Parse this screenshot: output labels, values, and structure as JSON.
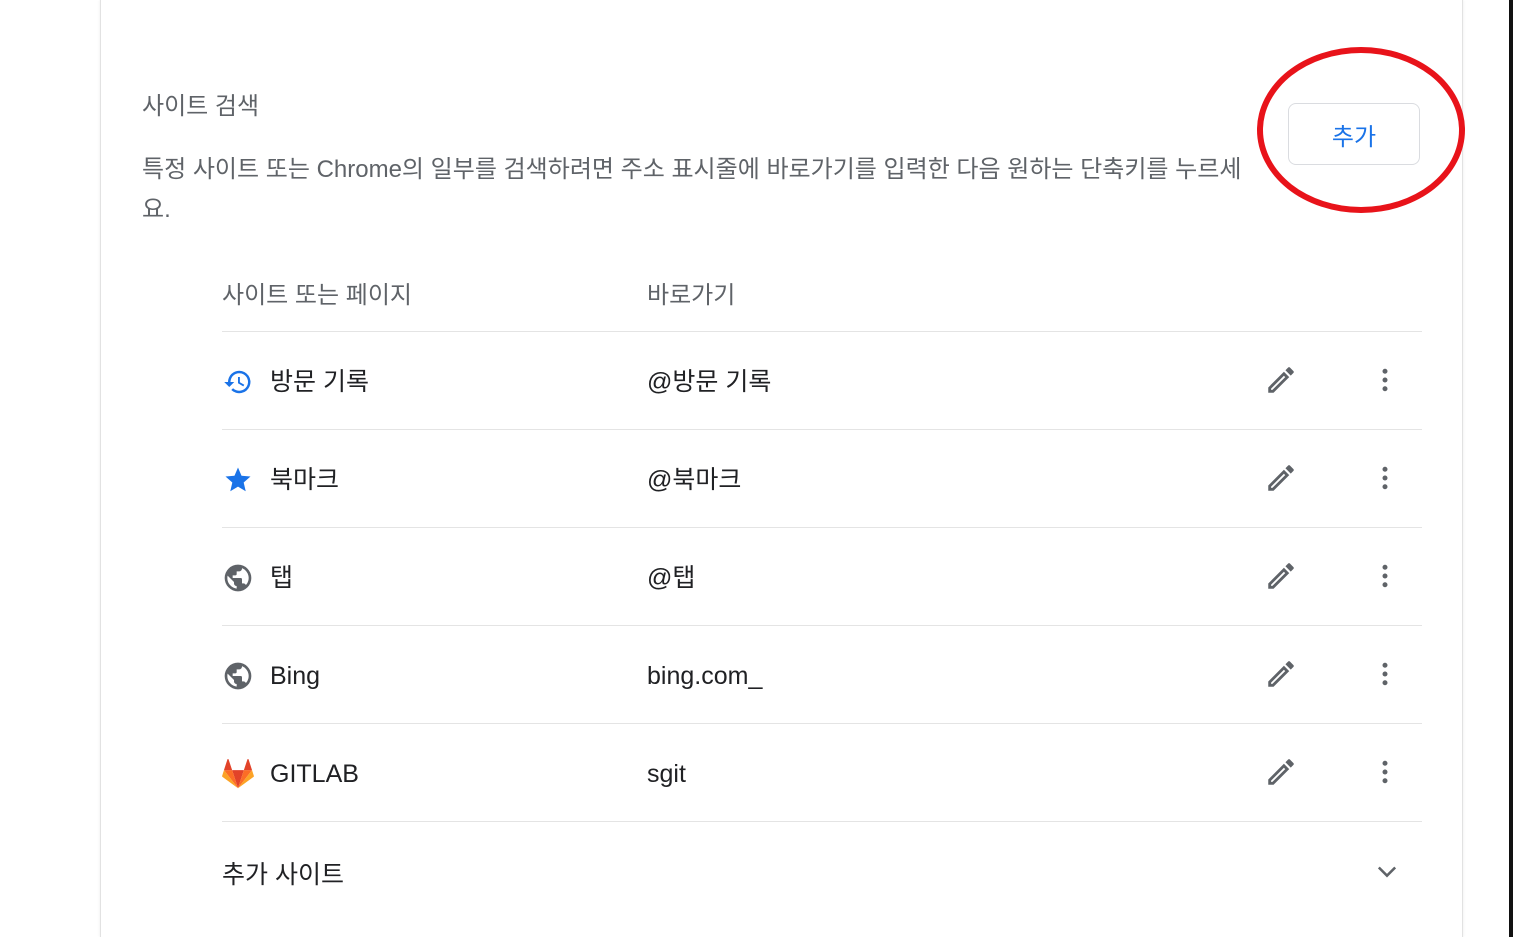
{
  "section": {
    "title": "사이트 검색",
    "description_line1": "특정 사이트 또는 Chrome의 일부를 검색하려면 주소 표시줄에 바로가기를 입력한 다음 원하는 단축키를 누르세",
    "description_line2": "요.",
    "add_button_label": "추가"
  },
  "table": {
    "columns": [
      "사이트 또는 페이지",
      "바로가기"
    ],
    "rows": [
      {
        "name": "방문 기록",
        "shortcut": "@방문 기록",
        "icon": "history-icon"
      },
      {
        "name": "북마크",
        "shortcut": "@북마크",
        "icon": "star-icon"
      },
      {
        "name": "탭",
        "shortcut": "@탭",
        "icon": "globe-icon"
      },
      {
        "name": "Bing",
        "shortcut": "bing.com_",
        "icon": "globe-icon"
      },
      {
        "name": "GITLAB",
        "shortcut": "sgit",
        "icon": "gitlab-icon"
      }
    ],
    "more_sites_label": "추가 사이트"
  },
  "colors": {
    "accent": "#1a73e8",
    "highlight_annotation": "#e8131a",
    "secondary_text": "#5f6368"
  }
}
